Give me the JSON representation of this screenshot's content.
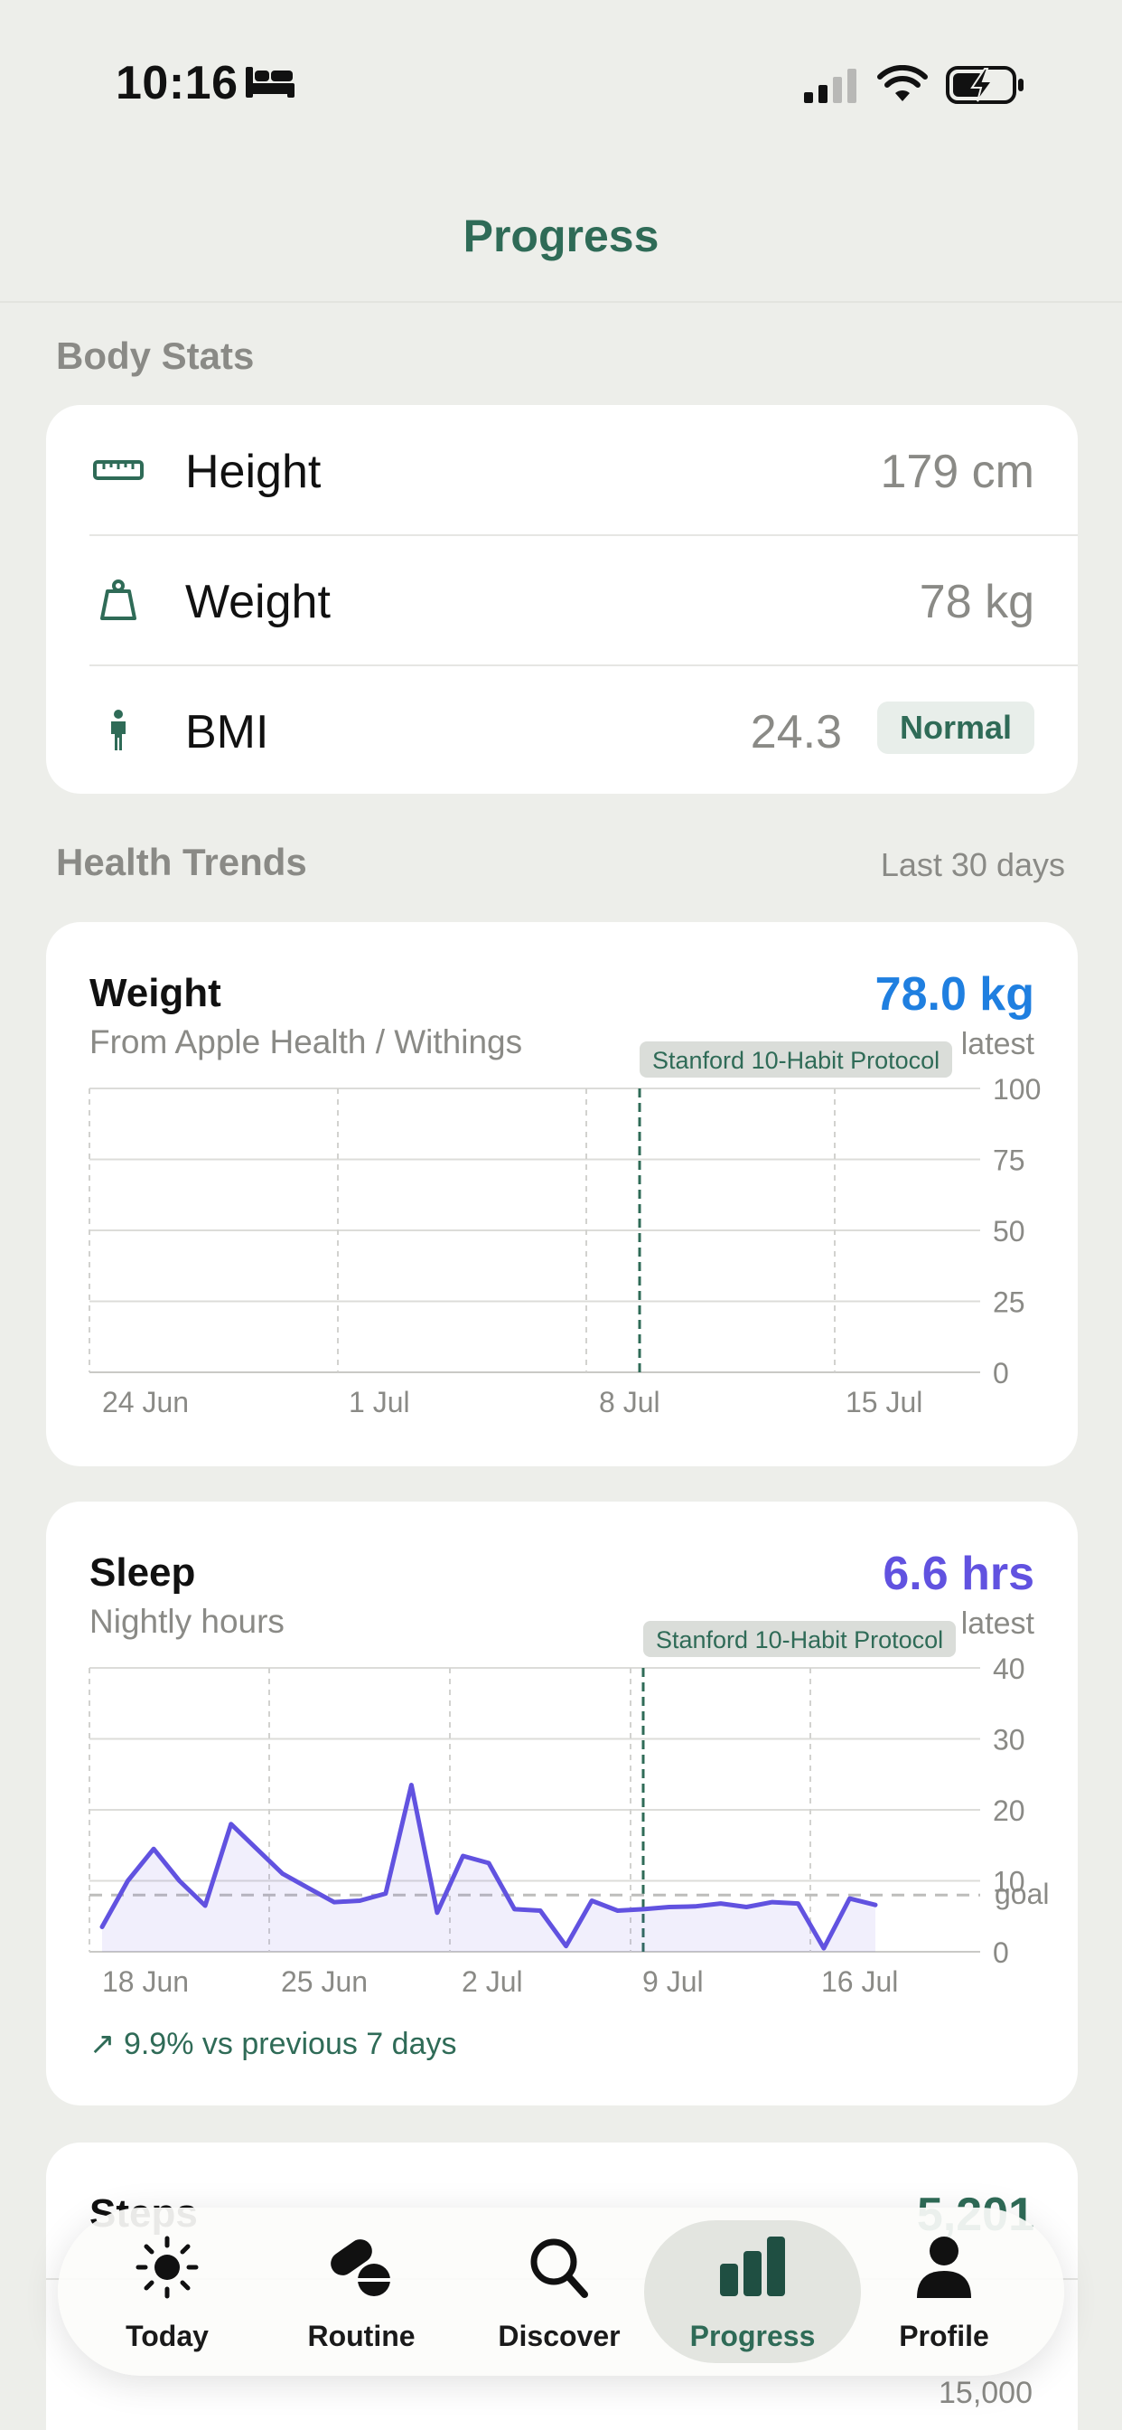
{
  "status_bar": {
    "time": "10:16"
  },
  "nav": {
    "title": "Progress"
  },
  "body_stats": {
    "section_title": "Body Stats",
    "rows": [
      {
        "icon": "ruler-icon",
        "label": "Height",
        "value": "179 cm"
      },
      {
        "icon": "weight-scale-icon",
        "label": "Weight",
        "value": "78 kg"
      },
      {
        "icon": "person-icon",
        "label": "BMI",
        "value": "24.3",
        "badge": "Normal"
      }
    ]
  },
  "health_trends": {
    "section_title": "Health Trends",
    "range_label": "Last 30 days",
    "weight_card": {
      "title": "Weight",
      "subtitle": "From Apple Health / Withings",
      "metric": "78.0 kg",
      "latest_label": "latest",
      "marker_label": "Stanford 10-Habit Protocol",
      "chart_data": {
        "type": "line",
        "title": "Weight",
        "ylim": [
          0,
          100
        ],
        "y_ticks": [
          "100",
          "75",
          "50",
          "25",
          "0"
        ],
        "x_ticks": [
          "24 Jun",
          "1 Jul",
          "8 Jul",
          "15 Jul"
        ],
        "series": [],
        "grid": true,
        "accent_color": "#1f7fe0"
      }
    },
    "sleep_card": {
      "title": "Sleep",
      "subtitle": "Nightly hours",
      "metric": "6.6 hrs",
      "latest_label": "latest",
      "goal_label": "goal",
      "marker_label": "Stanford 10-Habit Protocol",
      "trend_text": "9.9% vs previous 7 days",
      "chart_data": {
        "type": "area",
        "title": "Sleep",
        "ylim": [
          0,
          40
        ],
        "y_ticks": [
          "40",
          "30",
          "20",
          "10",
          "0"
        ],
        "x_ticks": [
          "18 Jun",
          "25 Jun",
          "2 Jul",
          "9 Jul",
          "16 Jul"
        ],
        "goal": 8,
        "series": [
          {
            "values": [
              3.5,
              10,
              14.5,
              10,
              6.5,
              18,
              14.5,
              11,
              9,
              7,
              7.2,
              8.2,
              23.5,
              5.5,
              13.5,
              12.5,
              6,
              5.8,
              0.8,
              7.2,
              5.8,
              6,
              6.3,
              6.4,
              6.8,
              6.3,
              7,
              6.8,
              0.5,
              7.5,
              6.6
            ]
          }
        ],
        "grid": true,
        "accent_color": "#6152e0"
      }
    },
    "steps_card_partial": {
      "title": "Steps",
      "metric": "5,201",
      "tick": "15,000"
    }
  },
  "tab_bar": {
    "tabs": [
      {
        "icon": "sun-icon",
        "label": "Today"
      },
      {
        "icon": "pills-icon",
        "label": "Routine"
      },
      {
        "icon": "search-icon",
        "label": "Discover"
      },
      {
        "icon": "bar-chart-icon",
        "label": "Progress"
      },
      {
        "icon": "person-icon",
        "label": "Profile"
      }
    ],
    "active_tab": "Progress"
  },
  "colors": {
    "brand_green": "#2f6b57",
    "weight_blue": "#1f7fe0",
    "sleep_purple": "#6152e0",
    "background": "#edeeea"
  }
}
